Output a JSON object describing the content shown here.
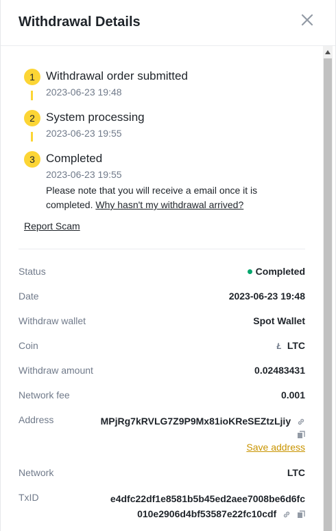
{
  "header": {
    "title": "Withdrawal Details"
  },
  "timeline": {
    "steps": [
      {
        "number": "1",
        "title": "Withdrawal order submitted",
        "time": "2023-06-23 19:48"
      },
      {
        "number": "2",
        "title": "System processing",
        "time": "2023-06-23 19:55"
      },
      {
        "number": "3",
        "title": "Completed",
        "time": "2023-06-23 19:55",
        "note": "Please note that you will receive a email once it is completed.",
        "note_link": "Why hasn't my withdrawal arrived?"
      }
    ]
  },
  "report_scam": "Report Scam",
  "details": {
    "status": {
      "label": "Status",
      "value": "Completed"
    },
    "date": {
      "label": "Date",
      "value": "2023-06-23 19:48"
    },
    "wallet": {
      "label": "Withdraw wallet",
      "value": "Spot Wallet"
    },
    "coin": {
      "label": "Coin",
      "value": "LTC",
      "icon": "litecoin-icon",
      "icon_glyph": "Ł"
    },
    "amount": {
      "label": "Withdraw amount",
      "value": "0.02483431"
    },
    "fee": {
      "label": "Network fee",
      "value": "0.001"
    },
    "address": {
      "label": "Address",
      "value": "MPjRg7kRVLG7Z9P9Mx81ioKReSEZtzLjiy",
      "save_label": "Save address"
    },
    "network": {
      "label": "Network",
      "value": "LTC"
    },
    "txid": {
      "label": "TxID",
      "line1": "e4dfc22df1e8581b5b45ed2aee7008be6d6fc",
      "line2": "010e2906d4bf53587e22fc10cdf"
    }
  },
  "colors": {
    "accent": "#fcd535",
    "link_gold": "#c99400",
    "success": "#03a66d",
    "muted": "#707a8a",
    "text": "#1e2329"
  }
}
